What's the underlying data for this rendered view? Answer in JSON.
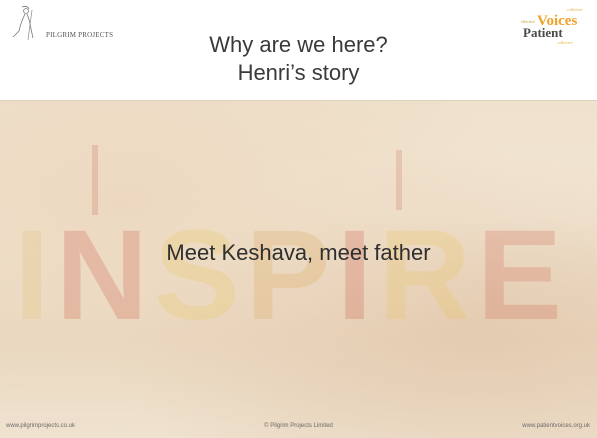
{
  "header": {
    "title_line1": "Why are we here?",
    "title_line2": "Henri’s story",
    "left_logo_text": "PILGRIM PROJECTS",
    "right_logo": {
      "small_top": "collective",
      "word1": "Voices",
      "word1_prefix": "effective",
      "word2": "Patient",
      "small_bottom": "collective"
    }
  },
  "main": {
    "text": "Meet Keshava, meet father",
    "background_word": "INSPIRE"
  },
  "footer": {
    "left": "www.pilgrimprojects.co.uk",
    "center": "© Pilgrim Projects Limited",
    "right": "www.patientvoices.org.uk"
  },
  "colors": {
    "title": "#3a3a3a",
    "body_text": "#2f2f2f",
    "voices_orange": "#f0a22a",
    "patient_dark": "#4a4a4a",
    "slide_bg": "#f4ecde"
  }
}
